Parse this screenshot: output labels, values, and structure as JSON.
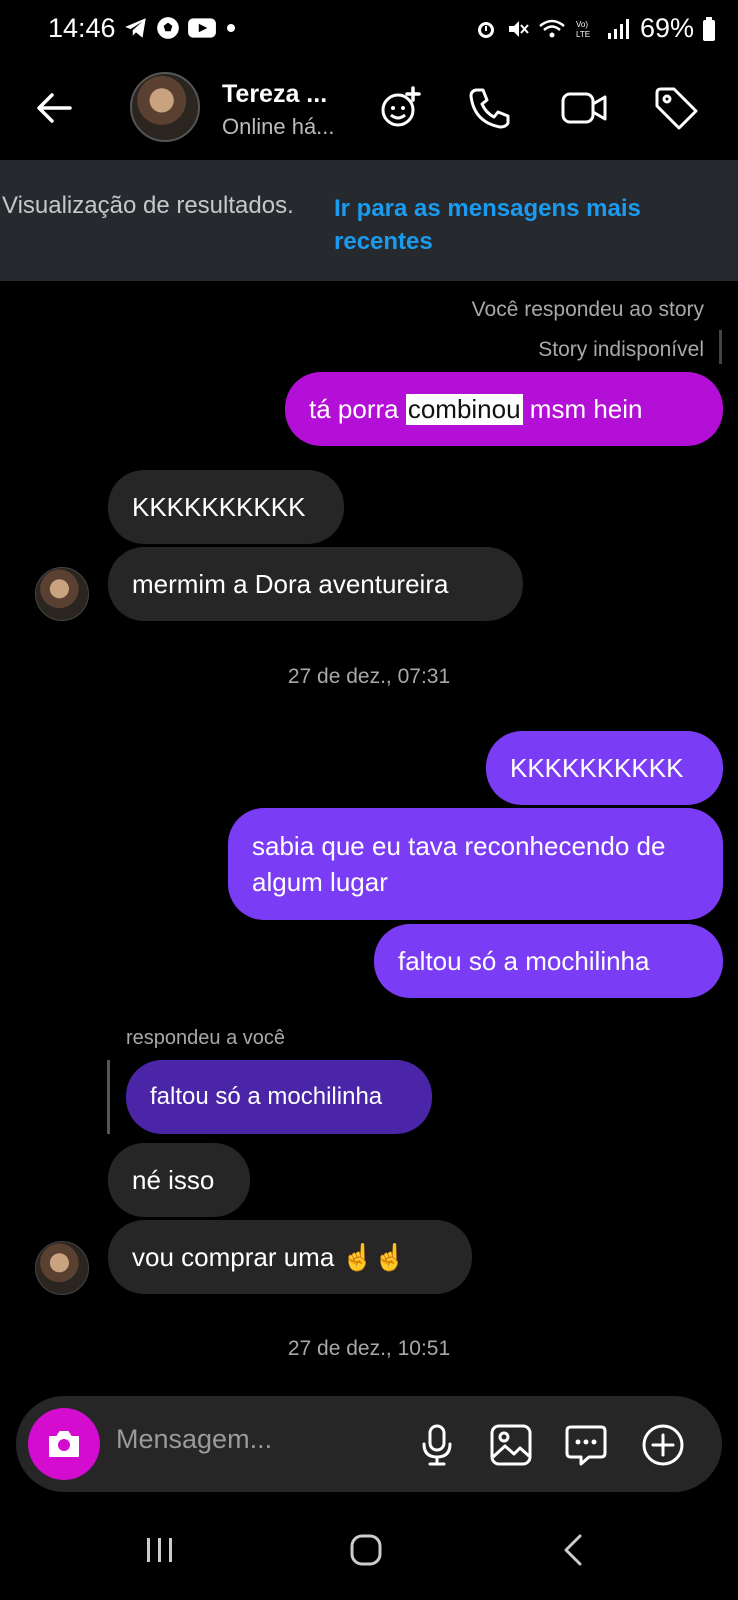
{
  "status_bar": {
    "time": "14:46",
    "left_icons": [
      "telegram-icon",
      "soccer-icon",
      "youtube-icon",
      "dot-icon"
    ],
    "right_icons": [
      "alarm-icon",
      "mute-icon",
      "wifi-icon",
      "volte-icon",
      "signal-icon"
    ],
    "battery": "69%"
  },
  "header": {
    "contact_name": "Tereza ...",
    "contact_status": "Online há...",
    "icons": [
      "back-arrow-icon",
      "add-effect-icon",
      "phone-icon",
      "video-icon",
      "tag-icon"
    ]
  },
  "search_banner": {
    "label": "Visualização de resultados.",
    "link": "Ir para as mensagens mais recentes"
  },
  "story_reply": {
    "replied_label": "Você respondeu ao story",
    "story_status": "Story indisponível"
  },
  "messages": {
    "m1_prefix": "tá porra ",
    "m1_highlight": "combinou",
    "m1_suffix": " msm hein",
    "m2": "KKKKKKKKKK",
    "m3": "mermim a Dora aventureira",
    "ts1": "27 de dez., 07:31",
    "m4": "KKKKKKKKKK",
    "m5": "sabia que eu tava reconhecendo de algum lugar",
    "m6": "faltou só a mochilinha",
    "reply_label": "respondeu a você",
    "reply_quote": "faltou só a mochilinha",
    "m7": "né isso",
    "m8": "vou comprar uma ☝️☝️",
    "ts2": "27 de dez., 10:51"
  },
  "composer": {
    "placeholder": "Mensagem..."
  },
  "colors": {
    "sent_magenta": "#b30fd6",
    "sent_purple": "#7b3cf5",
    "received": "#262626",
    "reply_quote": "#4a25a8",
    "link_blue": "#1a9bf0",
    "camera_pink": "#d30ccf"
  }
}
